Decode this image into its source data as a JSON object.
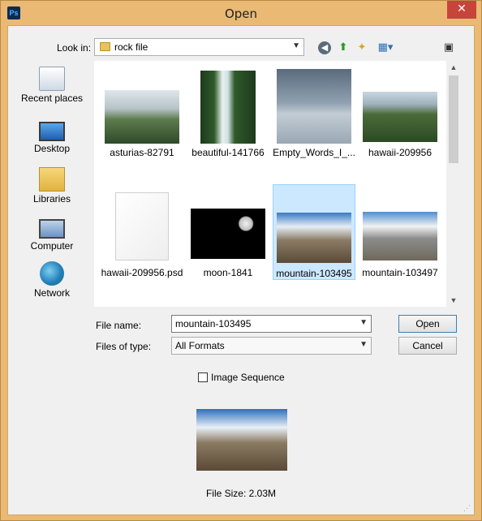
{
  "window": {
    "title": "Open",
    "app_icon": "Ps",
    "close_glyph": "✕"
  },
  "lookin": {
    "label": "Look in:",
    "value": "rock file"
  },
  "toolbar": {
    "back_icon": "back-arrow-icon",
    "up_icon": "up-folder-icon",
    "new_folder_icon": "new-folder-icon",
    "view_icon": "view-menu-icon",
    "extra_icon": "folder-settings-icon"
  },
  "places": [
    {
      "label": "Recent places",
      "icon": "recent-places-icon"
    },
    {
      "label": "Desktop",
      "icon": "desktop-icon"
    },
    {
      "label": "Libraries",
      "icon": "libraries-icon"
    },
    {
      "label": "Computer",
      "icon": "computer-icon"
    },
    {
      "label": "Network",
      "icon": "network-icon"
    }
  ],
  "files": [
    {
      "name": "asturias-82791",
      "selected": false
    },
    {
      "name": "beautiful-141766",
      "selected": false
    },
    {
      "name": "Empty_Words_I_...",
      "selected": false
    },
    {
      "name": "hawaii-209956",
      "selected": false
    },
    {
      "name": "hawaii-209956.psd",
      "selected": false
    },
    {
      "name": "moon-1841",
      "selected": false
    },
    {
      "name": "mountain-103495",
      "selected": true
    },
    {
      "name": "mountain-103497",
      "selected": false
    }
  ],
  "form": {
    "file_name_label": "File name:",
    "file_name_value": "mountain-103495",
    "files_of_type_label": "Files of type:",
    "files_of_type_value": "All Formats"
  },
  "buttons": {
    "open": "Open",
    "cancel": "Cancel"
  },
  "image_sequence": {
    "label": "Image Sequence",
    "checked": false
  },
  "preview": {
    "file_size_text": "File Size: 2.03M"
  },
  "colors": {
    "frame": "#eab973",
    "selection": "#cce8ff",
    "close_button": "#c7443a"
  }
}
